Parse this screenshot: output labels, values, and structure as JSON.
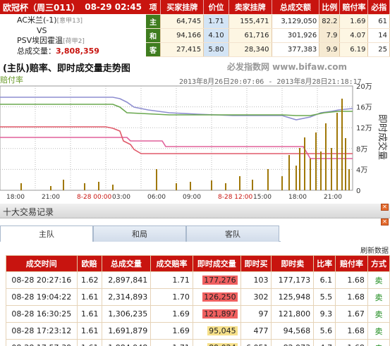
{
  "match": {
    "competition": "欧冠杯（周三011）",
    "datetime": "08-29 02:45",
    "home": "AC米兰(-1)",
    "home_rank": "[意甲13]",
    "vs": "VS",
    "away": "PSV埃因霍温",
    "away_rank": "[荷甲2]",
    "total_label": "总成交量：",
    "total_value": "3,808,359"
  },
  "odds": {
    "headers": [
      "项",
      "买家挂牌",
      "价位",
      "卖家挂牌",
      "总成交额",
      "比例",
      "赔付率",
      "必指"
    ],
    "rows": [
      {
        "sel": "主",
        "buy": "64,745",
        "price": "1.71",
        "sell": "155,471",
        "vol": "3,129,050",
        "ratio": "82.2",
        "payout": "1.69",
        "profit": "61"
      },
      {
        "sel": "和",
        "buy": "94,166",
        "price": "4.10",
        "sell": "61,716",
        "vol": "301,926",
        "ratio": "7.9",
        "payout": "4.07",
        "profit": "14"
      },
      {
        "sel": "客",
        "buy": "27,415",
        "price": "5.80",
        "sell": "28,340",
        "vol": "377,383",
        "ratio": "9.9",
        "payout": "6.19",
        "profit": "25"
      }
    ]
  },
  "chart_section": {
    "title": "(主队)赔率、即时成交量走势图",
    "watermark": "必发指数网 www.bifaw.com",
    "series_label": "赔付率",
    "range": "2013年8月26日20:07:06 - 2013年8月28日21:18:17",
    "y2_label": "即时成交量"
  },
  "chart_data": {
    "type": "line",
    "x_tick_labels": [
      "18:00",
      "21:00",
      "8-28 00:00",
      "03:00",
      "06:00",
      "09:00",
      "8-28 12:00",
      "15:00",
      "18:00",
      "21:00"
    ],
    "y_left_ticks": [
      "2",
      "1.5",
      "1",
      "0.5",
      "0"
    ],
    "y_right_ticks": [
      "20万",
      "16万",
      "12万",
      "8万",
      "4万",
      "0"
    ],
    "colors": {
      "green": "#6aa84f",
      "purple": "#8e8ed0",
      "red": "#e05a6a",
      "pink": "#e0609a",
      "bars": "#a07808"
    },
    "series": [
      {
        "name": "赔付率",
        "approx": "1.68-1.73 (green)"
      }
    ]
  },
  "trades": {
    "section_title": "十大交易记录",
    "close": "✕",
    "tabs": [
      "主队",
      "和局",
      "客队"
    ],
    "refresh": "刷新数据",
    "headers": [
      "成交时间",
      "欧赔",
      "总成交量",
      "成交赔率",
      "即时成交量",
      "即时买",
      "即时卖",
      "比率",
      "赔付率",
      "方式"
    ],
    "rows": [
      {
        "time": "08-28 20:27:16",
        "eu": "1.62",
        "total": "2,897,841",
        "odds": "1.71",
        "instant": "177,276",
        "hl": "red",
        "buy": "103",
        "sell": "177,173",
        "ratio": "6.1",
        "payout": "1.68",
        "way": "卖"
      },
      {
        "time": "08-28 19:04:22",
        "eu": "1.61",
        "total": "2,314,893",
        "odds": "1.70",
        "instant": "126,250",
        "hl": "red",
        "buy": "302",
        "sell": "125,948",
        "ratio": "5.5",
        "payout": "1.68",
        "way": "卖"
      },
      {
        "time": "08-28 16:30:25",
        "eu": "1.61",
        "total": "1,306,235",
        "odds": "1.69",
        "instant": "121,897",
        "hl": "red",
        "buy": "97",
        "sell": "121,800",
        "ratio": "9.3",
        "payout": "1.67",
        "way": "卖"
      },
      {
        "time": "08-28 17:23:12",
        "eu": "1.61",
        "total": "1,691,879",
        "odds": "1.69",
        "instant": "95,045",
        "hl": "yel",
        "buy": "477",
        "sell": "94,568",
        "ratio": "5.6",
        "payout": "1.68",
        "way": "卖"
      },
      {
        "time": "08-28 17:57:39",
        "eu": "1.61",
        "total": "1,884,948",
        "odds": "1.71",
        "instant": "89,024",
        "hl": "yel",
        "buy": "6,051",
        "sell": "82,973",
        "ratio": "4.7",
        "payout": "1.68",
        "way": "卖"
      }
    ]
  }
}
